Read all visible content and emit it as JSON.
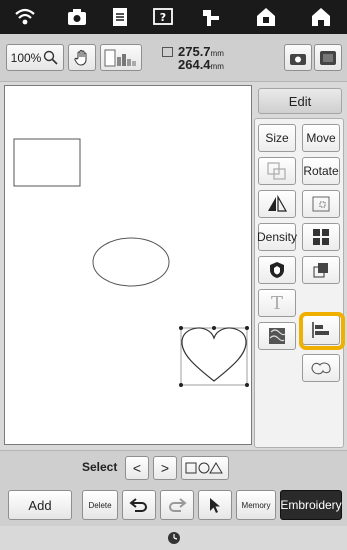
{
  "topbar": {
    "icons": [
      "wifi-icon",
      "camera-icon",
      "document-icon",
      "help-icon",
      "thread-icon",
      "home-lock-icon",
      "home-icon"
    ]
  },
  "toolbar": {
    "zoom_label": "100%",
    "width_value": "275.7",
    "height_value": "264.4",
    "unit": "mm"
  },
  "panel": {
    "edit_label": "Edit",
    "size_label": "Size",
    "move_label": "Move",
    "rotate_label": "Rotate",
    "density_label": "Density",
    "text_glyph": "T"
  },
  "select_row": {
    "label": "Select",
    "prev_glyph": "<",
    "next_glyph": ">"
  },
  "bottom": {
    "add_label": "Add",
    "delete_label": "Delete",
    "memory_label": "Memory",
    "embroidery_label": "Embroidery"
  },
  "colors": {
    "highlight": "#f0b000",
    "embroidery_bg": "#2a2a2a"
  }
}
